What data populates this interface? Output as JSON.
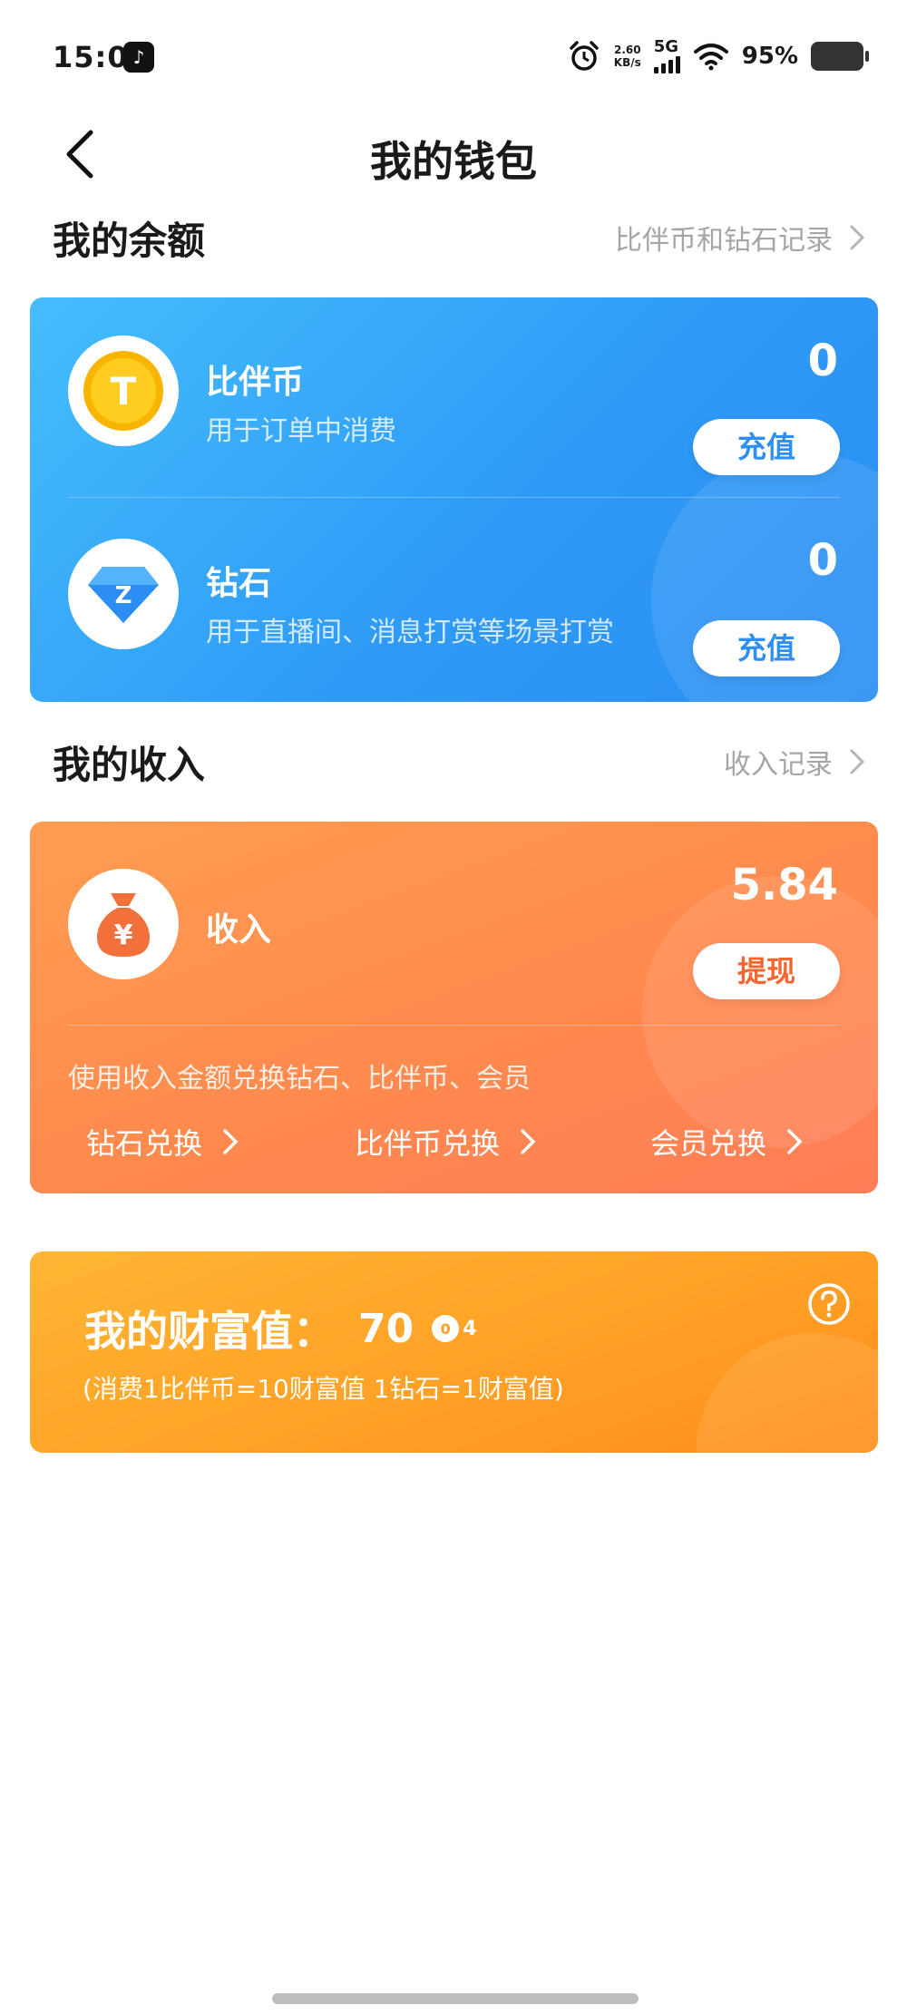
{
  "status_bar": {
    "time": "15:02",
    "net_speed": "2.60",
    "net_unit": "KB/s",
    "network": "5G",
    "battery": "95%"
  },
  "nav": {
    "title": "我的钱包"
  },
  "balance_section": {
    "title": "我的余额",
    "link": "比伴币和钻石记录"
  },
  "balance_card": {
    "coin": {
      "icon": "coin-icon",
      "icon_text": "T",
      "title": "比伴币",
      "subtitle": "用于订单中消费",
      "value": "0",
      "button": "充值"
    },
    "diamond": {
      "icon": "diamond-icon",
      "icon_text": "Z",
      "title": "钻石",
      "subtitle": "用于直播间、消息打赏等场景打赏",
      "value": "0",
      "button": "充值"
    },
    "colors": {
      "start": "#45bdfd",
      "end": "#2a8ef2"
    }
  },
  "income_section": {
    "title": "我的收入",
    "link": "收入记录"
  },
  "income_card": {
    "icon": "money-bag-icon",
    "icon_text": "¥",
    "title": "收入",
    "value": "5.84",
    "button": "提现",
    "note": "使用收入金额兑换钻石、比伴币、会员",
    "links": [
      "钻石兑换",
      "比伴币兑换",
      "会员兑换"
    ],
    "colors": {
      "start": "#ff9d51",
      "end": "#ff7d57"
    }
  },
  "wealth_card": {
    "label": "我的财富值：",
    "value": "70",
    "level_badge": "0",
    "level_suffix": "4",
    "rule": "(消费1比伴币=10财富值 1钻石=1财富值)",
    "help_icon": "question-circle-icon",
    "colors": {
      "start": "#ffb634",
      "end": "#ff8f1d"
    }
  }
}
